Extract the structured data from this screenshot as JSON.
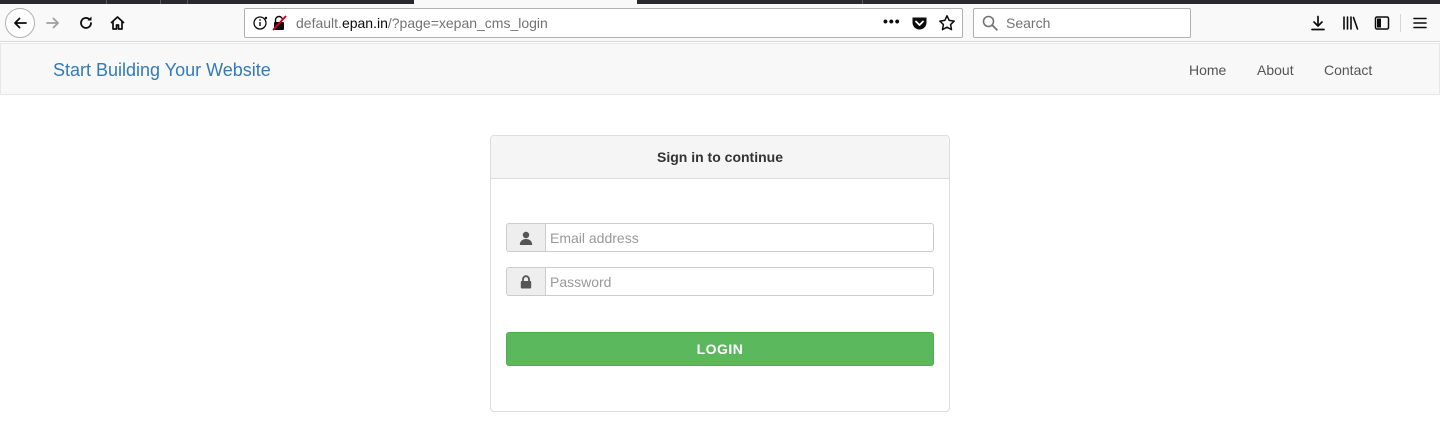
{
  "browser": {
    "url_prefix": "default.",
    "url_domain": "epan.in",
    "url_path": "/?page=xepan_cms_login",
    "url_more": "•••",
    "search_placeholder": "Search"
  },
  "navbar": {
    "brand": "Start Building Your Website",
    "links": [
      {
        "label": "Home"
      },
      {
        "label": "About"
      },
      {
        "label": "Contact"
      }
    ]
  },
  "login": {
    "heading": "Sign in to continue",
    "email_placeholder": "Email address",
    "password_placeholder": "Password",
    "button_label": "LOGIN"
  },
  "colors": {
    "brand_link": "#337ab7",
    "login_button": "#5cb85c"
  },
  "icons": {
    "back": "arrow-left-icon",
    "forward": "arrow-right-icon",
    "reload": "reload-icon",
    "home": "home-icon",
    "site_info": "info-icon",
    "insecure": "insecure-lock-icon",
    "pocket": "pocket-icon",
    "bookmark": "star-icon",
    "search": "search-icon",
    "downloads": "download-icon",
    "library": "library-icon",
    "sidebar": "sidebar-icon",
    "menu": "hamburger-menu-icon",
    "user": "user-icon",
    "password": "lock-icon"
  }
}
